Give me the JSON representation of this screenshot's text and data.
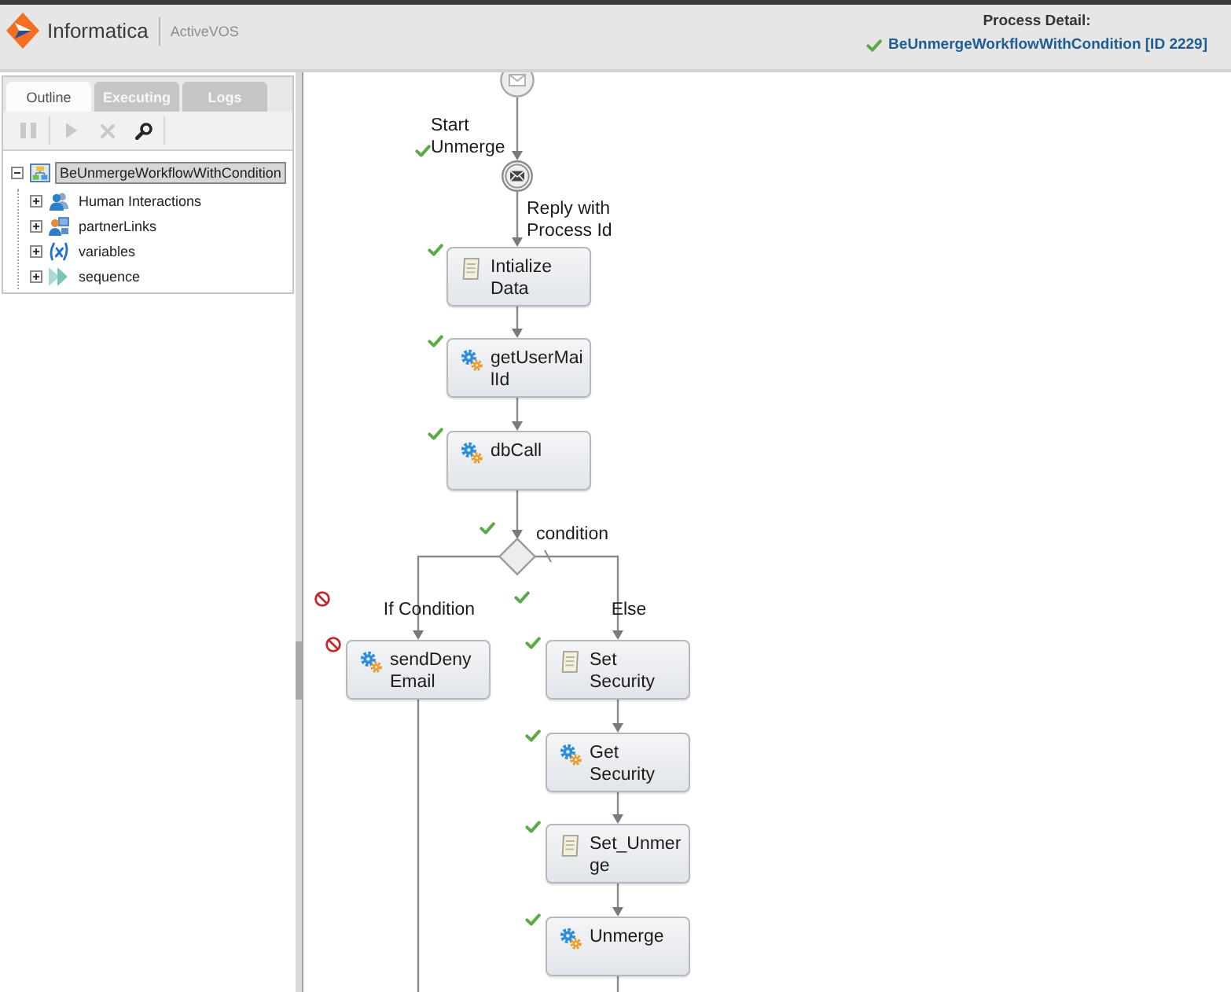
{
  "header": {
    "brand": "Informatica",
    "product": "ActiveVOS",
    "detail_title": "Process Detail:",
    "process": {
      "name": "BeUnmergeWorkflowWithCondition [ID 2229]",
      "completed": true,
      "skipped": false
    }
  },
  "outline_panel": {
    "tabs": [
      {
        "label": "Outline",
        "selected": true
      },
      {
        "label": "Executing",
        "selected": false
      },
      {
        "label": "Logs",
        "selected": false
      }
    ],
    "toolbar": [
      {
        "kind": "pause",
        "disabled": true
      },
      {
        "kind": "play",
        "disabled": true
      },
      {
        "kind": "stop",
        "disabled": true
      },
      {
        "kind": "search",
        "disabled": false
      }
    ],
    "tree": [
      {
        "label": "BeUnmergeWorkflowWithCondition",
        "kind": "process",
        "selected": true,
        "expanded": true,
        "children": [
          {
            "label": "Human Interactions",
            "kind": "people",
            "selected": false,
            "expanded": false
          },
          {
            "label": "partnerLinks",
            "kind": "partner-links",
            "selected": false,
            "expanded": false
          },
          {
            "label": "variables",
            "kind": "variables",
            "selected": false,
            "expanded": false
          },
          {
            "label": "sequence",
            "kind": "sequence",
            "selected": false,
            "expanded": false
          }
        ]
      }
    ]
  },
  "diagram": {
    "nodes": [
      {
        "kind": "start",
        "label": "Start Unmerge",
        "completed": true,
        "skipped": false
      },
      {
        "kind": "reply",
        "label": "Reply with Process Id",
        "completed": false,
        "skipped": false
      },
      {
        "kind": "assign",
        "label": "Intialize Data",
        "completed": true,
        "skipped": false
      },
      {
        "kind": "invoke",
        "label": "getUserMailId",
        "completed": true,
        "skipped": false
      },
      {
        "kind": "invoke",
        "label": "dbCall",
        "completed": true,
        "skipped": false
      }
    ],
    "gateway": {
      "label": "condition",
      "completed": true,
      "skipped": false
    },
    "branches": [
      {
        "label": "If Condition",
        "completed": false,
        "skipped": true,
        "default": false,
        "nodes": [
          {
            "kind": "invoke",
            "label": "sendDenyEmail",
            "completed": false,
            "skipped": true
          }
        ]
      },
      {
        "label": "Else",
        "completed": true,
        "skipped": false,
        "default": true,
        "nodes": [
          {
            "kind": "assign",
            "label": "Set Security",
            "completed": true,
            "skipped": false
          },
          {
            "kind": "invoke",
            "label": "Get Security",
            "completed": true,
            "skipped": false
          },
          {
            "kind": "assign",
            "label": "Set_Unmerge",
            "completed": true,
            "skipped": false
          },
          {
            "kind": "invoke",
            "label": "Unmerge",
            "completed": true,
            "skipped": false
          }
        ]
      }
    ]
  }
}
